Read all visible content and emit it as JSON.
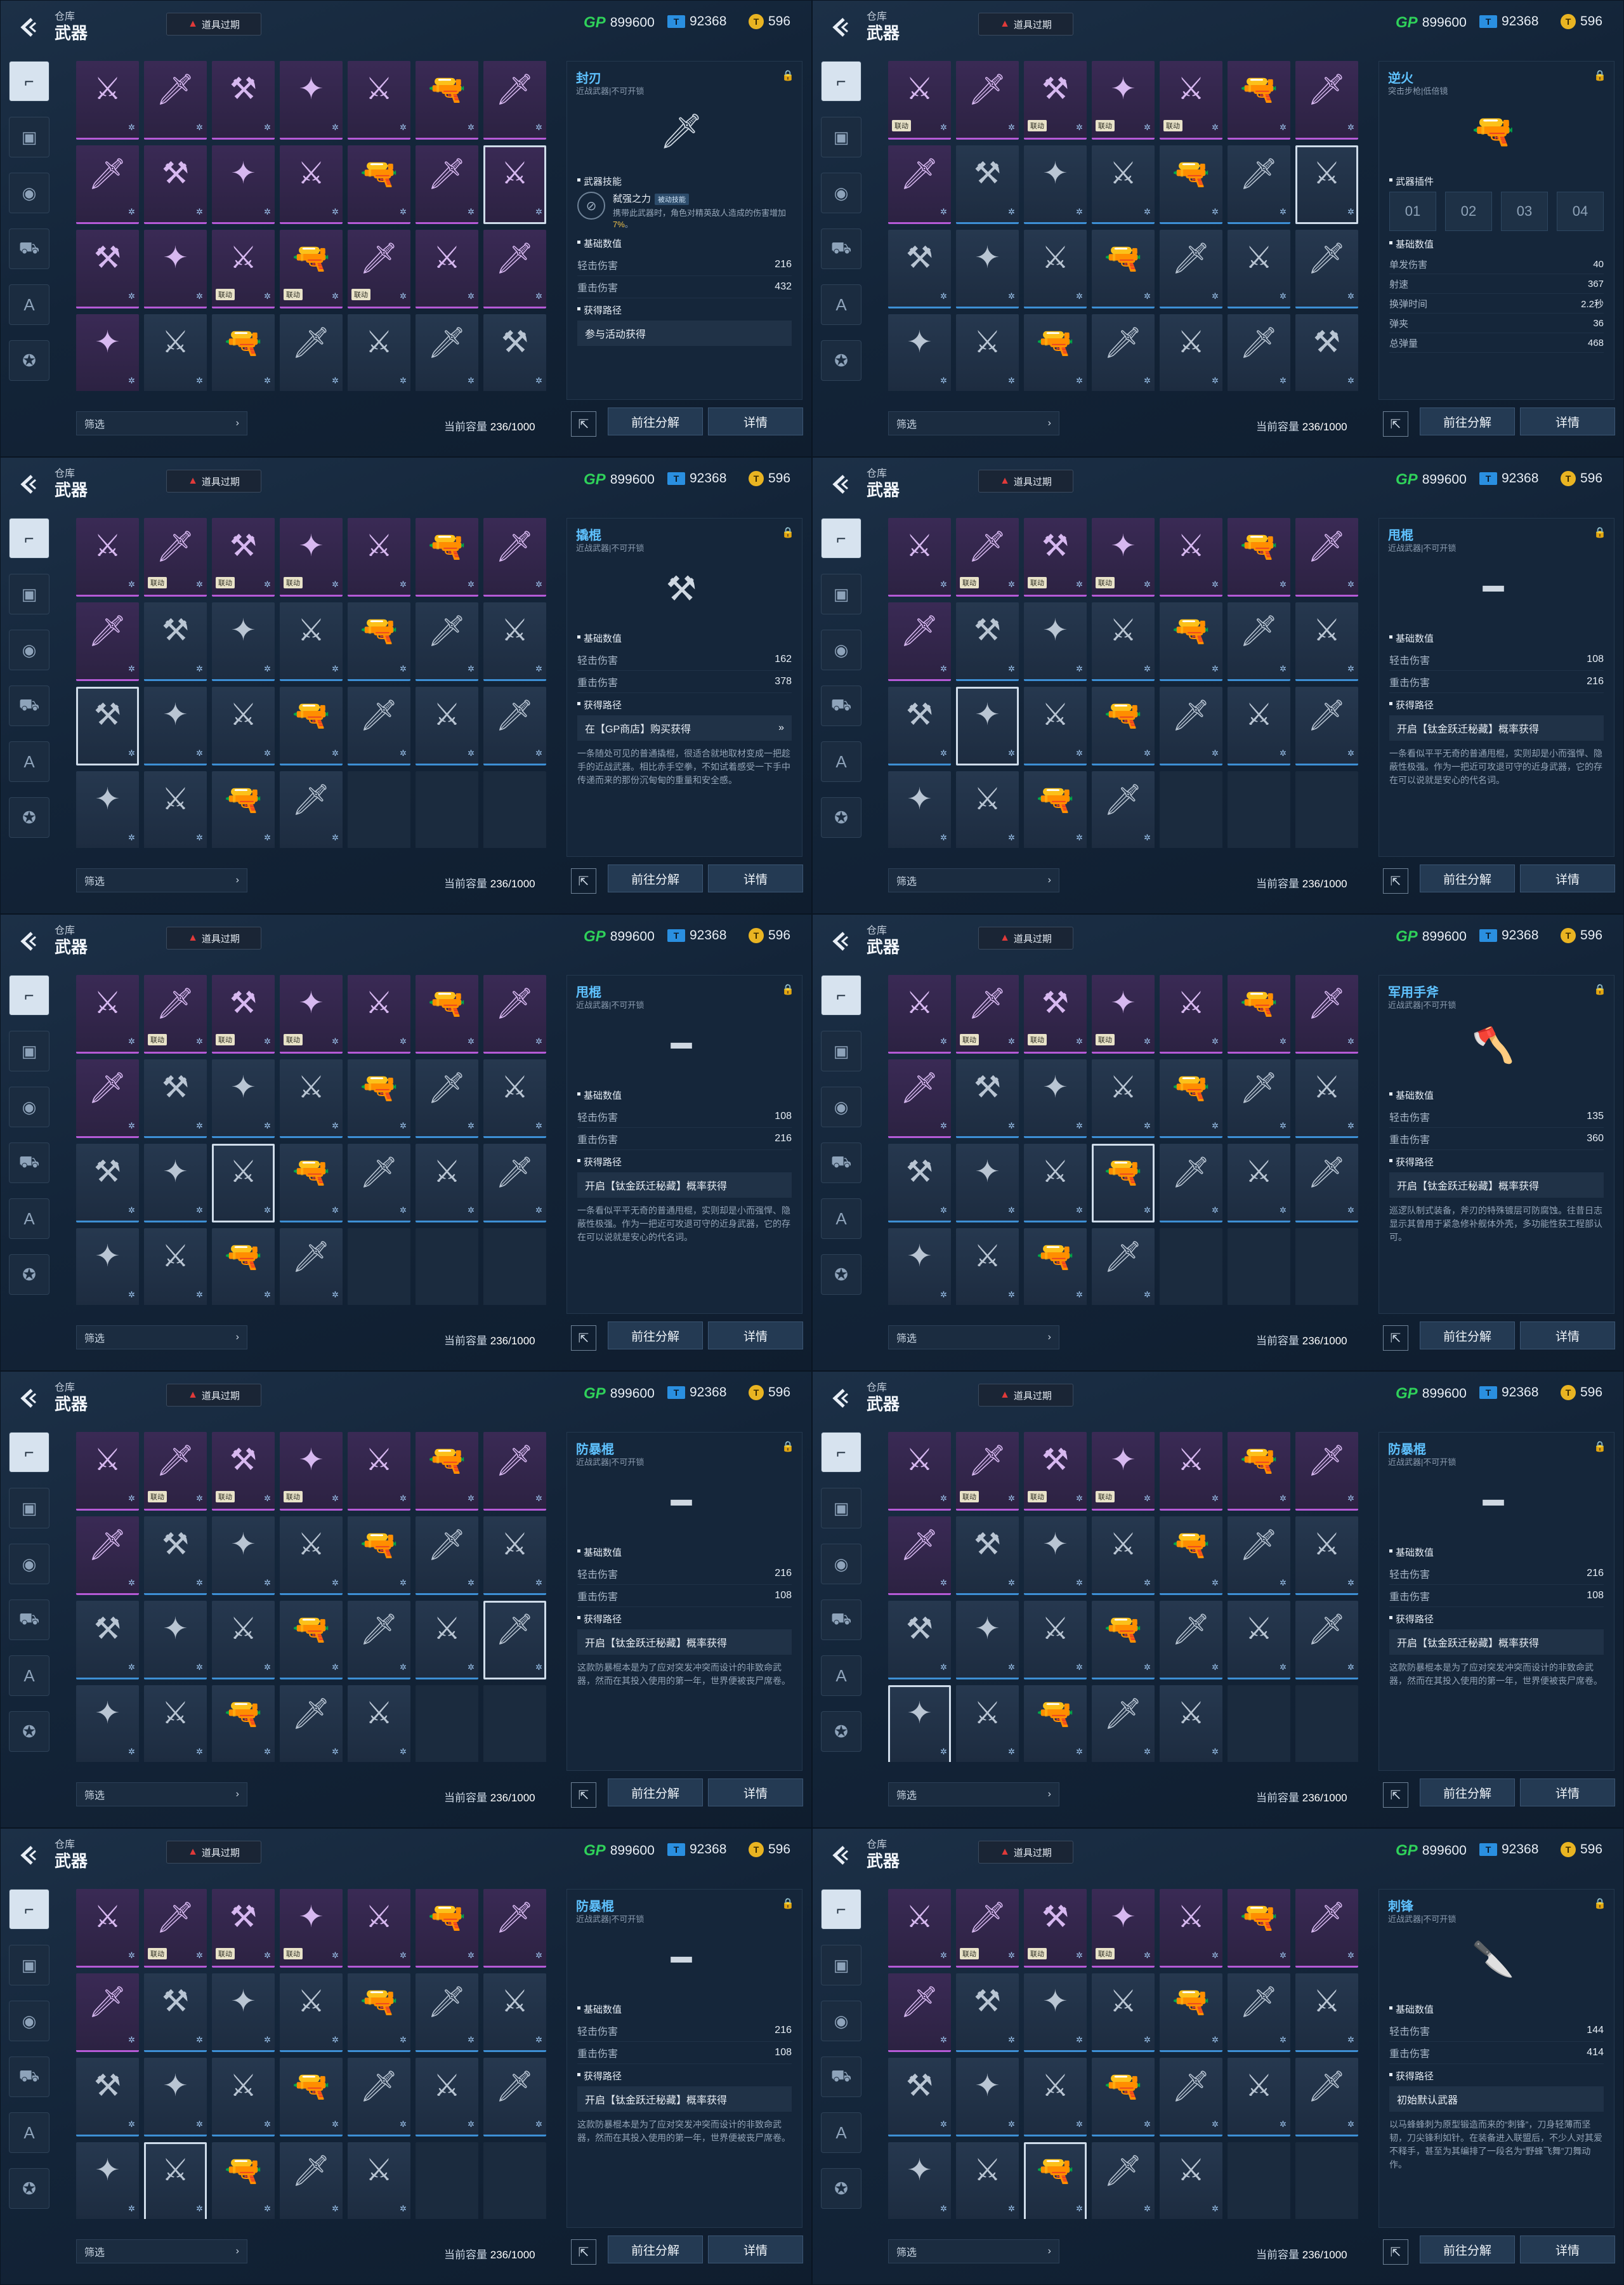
{
  "header": {
    "crumb": "仓库",
    "title": "武器",
    "expire_label": "道具过期"
  },
  "currency": {
    "gp": "899600",
    "tcoin": "92368",
    "coin": "596"
  },
  "footer": {
    "filter_label": "筛选",
    "capacity_label": "当前容量",
    "capacity_value": "236/1000",
    "decompose_label": "前往分解",
    "detail_label": "详情"
  },
  "labels": {
    "skill_section": "武器技能",
    "stats_section": "基础数值",
    "path_section": "获得路径",
    "mods_section": "武器插件",
    "linked_tag": "联动",
    "passive_tag": "被动技能"
  },
  "categories": [
    "pistol-icon",
    "box-icon",
    "grenade-icon",
    "vehicle-icon",
    "letter-a-icon",
    "emblem-icon"
  ],
  "screens": [
    {
      "selected": {
        "row": 1,
        "col": 6
      },
      "grid_rows": [
        [
          "purple",
          "purple",
          "purple",
          "purple",
          "purple",
          "purple",
          "purple"
        ],
        [
          "purple",
          "purple",
          "purple",
          "purple",
          "purple",
          "purple",
          "purple-sel"
        ],
        [
          "purple",
          "purple",
          "purple-tag",
          "purple-tag",
          "purple-tag",
          "purple",
          "purple"
        ],
        [
          "purple",
          "blue",
          "blue",
          "blue",
          "blue",
          "blue",
          "blue"
        ]
      ],
      "detail": {
        "name": "封刃",
        "subtitle": "近战武器|不可开锁",
        "art": "🗡",
        "skill": {
          "name": "弑强之力",
          "desc_pre": "携带此武器时，角色对精英敌人造成的伤害增加",
          "desc_hi": "7%",
          "desc_post": "。"
        },
        "stats": [
          {
            "label": "轻击伤害",
            "value": "216"
          },
          {
            "label": "重击伤害",
            "value": "432"
          }
        ],
        "path": "参与活动获得",
        "desc": ""
      }
    },
    {
      "selected": {
        "row": 1,
        "col": 6
      },
      "grid_rows": [
        [
          "purple-tag",
          "purple",
          "purple-tag",
          "purple-tag",
          "purple-tag",
          "purple",
          "purple"
        ],
        [
          "purple",
          "blue",
          "blue",
          "blue",
          "blue",
          "blue",
          "blue-sel"
        ],
        [
          "blue",
          "blue",
          "blue",
          "blue",
          "blue",
          "blue",
          "blue"
        ],
        [
          "blue",
          "blue",
          "blue",
          "blue",
          "blue",
          "blue",
          "blue"
        ]
      ],
      "detail": {
        "name": "逆火",
        "subtitle": "突击步枪|低倍镜",
        "art": "🔫",
        "mods": [
          "01",
          "02",
          "03",
          "04"
        ],
        "stats": [
          {
            "label": "单发伤害",
            "value": "40"
          },
          {
            "label": "射速",
            "value": "367"
          },
          {
            "label": "换弹时间",
            "value": "2.2秒"
          },
          {
            "label": "弹夹",
            "value": "36"
          },
          {
            "label": "总弹量",
            "value": "468"
          }
        ],
        "path": "",
        "desc": ""
      }
    },
    {
      "selected": {
        "row": 2,
        "col": 0
      },
      "grid_rows": [
        [
          "purple",
          "purple-tag",
          "purple-tag",
          "purple-tag",
          "purple",
          "purple",
          "purple"
        ],
        [
          "purple",
          "blue",
          "blue",
          "blue",
          "blue",
          "blue",
          "blue"
        ],
        [
          "blue-sel",
          "blue",
          "blue",
          "blue",
          "blue",
          "blue",
          "blue"
        ],
        [
          "blue",
          "blue",
          "blue",
          "blue",
          "empty",
          "empty",
          "empty"
        ]
      ],
      "detail": {
        "name": "撬棍",
        "subtitle": "近战武器|不可开锁",
        "art": "⚒",
        "stats": [
          {
            "label": "轻击伤害",
            "value": "162"
          },
          {
            "label": "重击伤害",
            "value": "378"
          }
        ],
        "path": "在【GP商店】购买获得",
        "path_arrow": "»",
        "desc": "一条随处可见的普通撬棍，很适合就地取材变成一把趁手的近战武器。相比赤手空拳，不如试着感受一下手中传递而来的那份沉甸甸的重量和安全感。"
      }
    },
    {
      "selected": {
        "row": 2,
        "col": 1
      },
      "grid_rows": [
        [
          "purple",
          "purple-tag",
          "purple-tag",
          "purple-tag",
          "purple",
          "purple",
          "purple"
        ],
        [
          "purple",
          "blue",
          "blue",
          "blue",
          "blue",
          "blue",
          "blue"
        ],
        [
          "blue",
          "blue-sel",
          "blue",
          "blue",
          "blue",
          "blue",
          "blue"
        ],
        [
          "blue",
          "blue",
          "blue",
          "blue",
          "empty",
          "empty",
          "empty"
        ]
      ],
      "detail": {
        "name": "甩棍",
        "subtitle": "近战武器|不可开锁",
        "art": "━",
        "stats": [
          {
            "label": "轻击伤害",
            "value": "108"
          },
          {
            "label": "重击伤害",
            "value": "216"
          }
        ],
        "path": "开启【钛金跃迁秘藏】概率获得",
        "desc": "一条看似平平无奇的普通甩棍，实则却是小而强悍、隐蔽性极强。作为一把近可攻退可守的近身武器，它的存在可以说就是安心的代名词。"
      }
    },
    {
      "selected": {
        "row": 2,
        "col": 2
      },
      "grid_rows": [
        [
          "purple",
          "purple-tag",
          "purple-tag",
          "purple-tag",
          "purple",
          "purple",
          "purple"
        ],
        [
          "purple",
          "blue",
          "blue",
          "blue",
          "blue",
          "blue",
          "blue"
        ],
        [
          "blue",
          "blue",
          "blue-sel",
          "blue",
          "blue",
          "blue",
          "blue"
        ],
        [
          "blue",
          "blue",
          "blue",
          "blue",
          "empty",
          "empty",
          "empty"
        ]
      ],
      "detail": {
        "name": "甩棍",
        "subtitle": "近战武器|不可开锁",
        "art": "━",
        "stats": [
          {
            "label": "轻击伤害",
            "value": "108"
          },
          {
            "label": "重击伤害",
            "value": "216"
          }
        ],
        "path": "开启【钛金跃迁秘藏】概率获得",
        "desc": "一条看似平平无奇的普通甩棍，实则却是小而强悍、隐蔽性极强。作为一把近可攻退可守的近身武器，它的存在可以说就是安心的代名词。"
      }
    },
    {
      "selected": {
        "row": 2,
        "col": 3
      },
      "grid_rows": [
        [
          "purple",
          "purple-tag",
          "purple-tag",
          "purple-tag",
          "purple",
          "purple",
          "purple"
        ],
        [
          "purple",
          "blue",
          "blue",
          "blue",
          "blue",
          "blue",
          "blue"
        ],
        [
          "blue",
          "blue",
          "blue",
          "blue-sel",
          "blue",
          "blue",
          "blue"
        ],
        [
          "blue",
          "blue",
          "blue",
          "blue",
          "empty",
          "empty",
          "empty"
        ]
      ],
      "detail": {
        "name": "军用手斧",
        "subtitle": "近战武器|不可开锁",
        "art": "🪓",
        "stats": [
          {
            "label": "轻击伤害",
            "value": "135"
          },
          {
            "label": "重击伤害",
            "value": "360"
          }
        ],
        "path": "开启【钛金跃迁秘藏】概率获得",
        "desc": "巡逻队制式装备，斧刃的特殊镀层可防腐蚀。往昔日志显示其曾用于紧急修补舰体外壳，多功能性获工程部认可。"
      }
    },
    {
      "selected": {
        "row": 2,
        "col": 6
      },
      "grid_rows": [
        [
          "purple",
          "purple-tag",
          "purple-tag",
          "purple-tag",
          "purple",
          "purple",
          "purple"
        ],
        [
          "purple",
          "blue",
          "blue",
          "blue",
          "blue",
          "blue",
          "blue"
        ],
        [
          "blue",
          "blue",
          "blue",
          "blue",
          "blue",
          "blue",
          "blue-sel"
        ],
        [
          "blue",
          "blue",
          "blue",
          "blue",
          "blue",
          "empty",
          "empty"
        ]
      ],
      "detail": {
        "name": "防暴棍",
        "subtitle": "近战武器|不可开锁",
        "art": "━",
        "stats": [
          {
            "label": "轻击伤害",
            "value": "216"
          },
          {
            "label": "重击伤害",
            "value": "108"
          }
        ],
        "path": "开启【钛金跃迁秘藏】概率获得",
        "desc": "这款防暴棍本是为了应对突发冲突而设计的非致命武器，然而在其投入使用的第一年，世界便被丧尸席卷。"
      }
    },
    {
      "selected": {
        "row": 3,
        "col": 0
      },
      "grid_rows": [
        [
          "purple",
          "purple-tag",
          "purple-tag",
          "purple-tag",
          "purple",
          "purple",
          "purple"
        ],
        [
          "purple",
          "blue",
          "blue",
          "blue",
          "blue",
          "blue",
          "blue"
        ],
        [
          "blue",
          "blue",
          "blue",
          "blue",
          "blue",
          "blue",
          "blue"
        ],
        [
          "blue-sel",
          "blue",
          "blue",
          "blue",
          "blue",
          "empty",
          "empty"
        ]
      ],
      "detail": {
        "name": "防暴棍",
        "subtitle": "近战武器|不可开锁",
        "art": "━",
        "stats": [
          {
            "label": "轻击伤害",
            "value": "216"
          },
          {
            "label": "重击伤害",
            "value": "108"
          }
        ],
        "path": "开启【钛金跃迁秘藏】概率获得",
        "desc": "这款防暴棍本是为了应对突发冲突而设计的非致命武器，然而在其投入使用的第一年，世界便被丧尸席卷。"
      }
    },
    {
      "selected": {
        "row": 3,
        "col": 1
      },
      "grid_rows": [
        [
          "purple",
          "purple-tag",
          "purple-tag",
          "purple-tag",
          "purple",
          "purple",
          "purple"
        ],
        [
          "purple",
          "blue",
          "blue",
          "blue",
          "blue",
          "blue",
          "blue"
        ],
        [
          "blue",
          "blue",
          "blue",
          "blue",
          "blue",
          "blue",
          "blue"
        ],
        [
          "blue",
          "blue-sel",
          "blue",
          "blue",
          "blue",
          "empty",
          "empty"
        ]
      ],
      "detail": {
        "name": "防暴棍",
        "subtitle": "近战武器|不可开锁",
        "art": "━",
        "stats": [
          {
            "label": "轻击伤害",
            "value": "216"
          },
          {
            "label": "重击伤害",
            "value": "108"
          }
        ],
        "path": "开启【钛金跃迁秘藏】概率获得",
        "desc": "这款防暴棍本是为了应对突发冲突而设计的非致命武器，然而在其投入使用的第一年，世界便被丧尸席卷。"
      }
    },
    {
      "selected": {
        "row": 3,
        "col": 2
      },
      "grid_rows": [
        [
          "purple",
          "purple-tag",
          "purple-tag",
          "purple-tag",
          "purple",
          "purple",
          "purple"
        ],
        [
          "purple",
          "blue",
          "blue",
          "blue",
          "blue",
          "blue",
          "blue"
        ],
        [
          "blue",
          "blue",
          "blue",
          "blue",
          "blue",
          "blue",
          "blue"
        ],
        [
          "blue",
          "blue",
          "blue-sel",
          "blue",
          "blue",
          "empty",
          "empty"
        ]
      ],
      "detail": {
        "name": "刺锋",
        "subtitle": "近战武器|不可开锁",
        "art": "🔪",
        "stats": [
          {
            "label": "轻击伤害",
            "value": "144"
          },
          {
            "label": "重击伤害",
            "value": "414"
          }
        ],
        "path": "初始默认武器",
        "desc": "以马蜂蜂刺为原型锻造而来的“刺锋”，刀身轻薄而坚韧，刀尖锋利如针。在装备进入联盟后，不少人对其爱不释手，甚至为其编排了一段名为“野蜂飞舞”刀舞动作。"
      }
    }
  ]
}
